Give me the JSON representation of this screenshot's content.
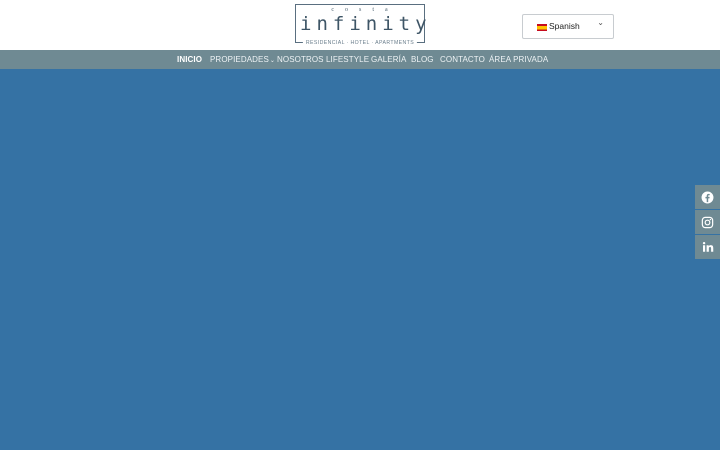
{
  "logo": {
    "top": "costa",
    "main": "infinity",
    "sub": "RESIDENCIAL · HOTEL · APARTMENTS"
  },
  "language": {
    "selected": "Spanish",
    "flag_icon": "spain-flag-icon"
  },
  "nav": {
    "items": [
      {
        "label": "INICIO",
        "active": true
      },
      {
        "label": "PROPIEDADES",
        "has_dropdown": true
      },
      {
        "label": "NOSOTROS"
      },
      {
        "label": "LIFESTYLE"
      },
      {
        "label": "GALERÍA"
      },
      {
        "label": "BLOG"
      },
      {
        "label": "CONTACTO"
      },
      {
        "label": "ÁREA PRIVADA"
      }
    ]
  },
  "social": [
    {
      "icon": "facebook-icon"
    },
    {
      "icon": "instagram-icon"
    },
    {
      "icon": "linkedin-icon"
    }
  ],
  "colors": {
    "hero_background": "#3572a4",
    "nav_background": "#6f8a93",
    "header_background": "#ffffff"
  }
}
